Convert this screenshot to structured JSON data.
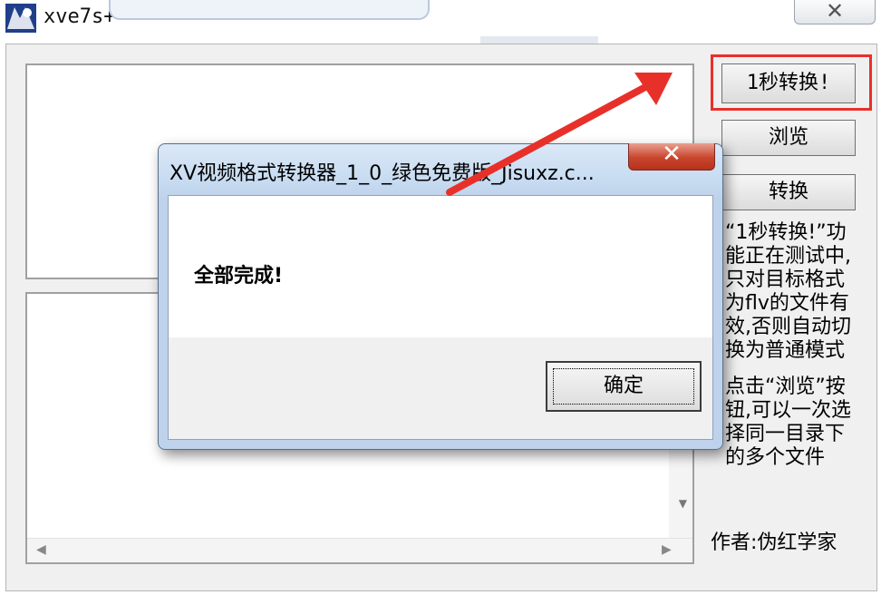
{
  "window": {
    "title": "xve7s+",
    "close_glyph": "✕"
  },
  "buttons": {
    "convert_1s": "1秒转换!",
    "browse": "浏览",
    "convert": "转换"
  },
  "info": {
    "para1": "“1秒转换!”功能正在测试中,只对目标格式为flv的文件有效,否则自动切换为普通模式",
    "para2": "点击“浏览”按钮,可以一次选择同一目录下的多个文件"
  },
  "author": "作者:伪红学家",
  "dialog": {
    "title": "XV视频格式转换器_1_0_绿色免费版_Jisuxz.c...",
    "close_glyph": "✕",
    "message": "全部完成!",
    "ok_label": "确定"
  },
  "colors": {
    "annotation": "#e8302a",
    "dialog_frame": "#c7dbf1",
    "close_red": "#c9452d"
  },
  "icons": [
    "app-icon",
    "close-icon",
    "scroll-down-icon",
    "scroll-left-icon",
    "scroll-right-icon",
    "dialog-close-icon"
  ]
}
